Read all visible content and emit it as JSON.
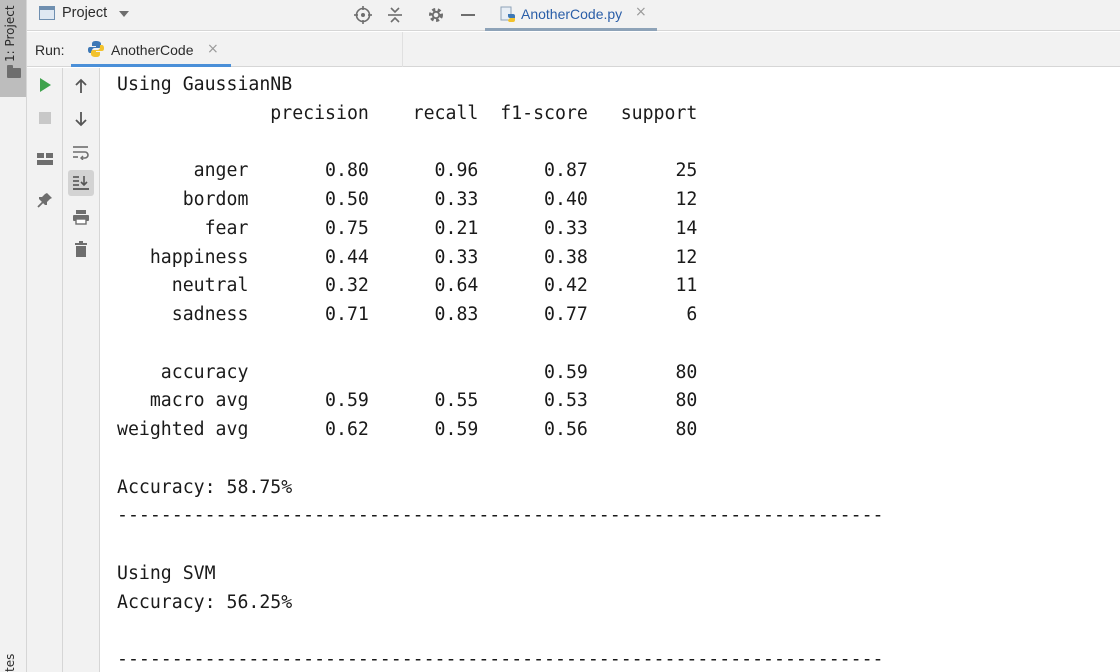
{
  "left_strip": {
    "project_tab_label": "1: Project",
    "bottom_tab_label": "tes"
  },
  "topbar": {
    "project_label": "Project",
    "file_tab": {
      "name": "AnotherCode.py",
      "close": "×"
    }
  },
  "run_window": {
    "run_label": "Run:",
    "run_tab": {
      "name": "AnotherCode",
      "close": "×"
    }
  },
  "console": {
    "lines": [
      "Using GaussianNB",
      "              precision    recall  f1-score   support",
      "",
      "       anger       0.80      0.96      0.87        25",
      "      bordom       0.50      0.33      0.40        12",
      "        fear       0.75      0.21      0.33        14",
      "   happiness       0.44      0.33      0.38        12",
      "     neutral       0.32      0.64      0.42        11",
      "     sadness       0.71      0.83      0.77         6",
      "",
      "    accuracy                           0.59        80",
      "   macro avg       0.59      0.55      0.53        80",
      "weighted avg       0.62      0.59      0.56        80",
      "",
      "Accuracy: 58.75%",
      "----------------------------------------------------------------------",
      "",
      "Using SVM",
      "Accuracy: 56.25%",
      "",
      "----------------------------------------------------------------------"
    ]
  },
  "icons": {
    "run": "run-icon",
    "stop": "stop-icon",
    "layout": "layout-icon",
    "pin": "pin-icon",
    "up": "arrow-up-icon",
    "down": "arrow-down-icon",
    "wrap": "soft-wrap-icon",
    "scroll_end": "scroll-to-end-icon",
    "print": "print-icon",
    "trash": "trash-icon"
  },
  "colors": {
    "run_green": "#3fa34d",
    "accent_blue": "#4a8fd8",
    "file_tab_text": "#2a5ea8"
  }
}
